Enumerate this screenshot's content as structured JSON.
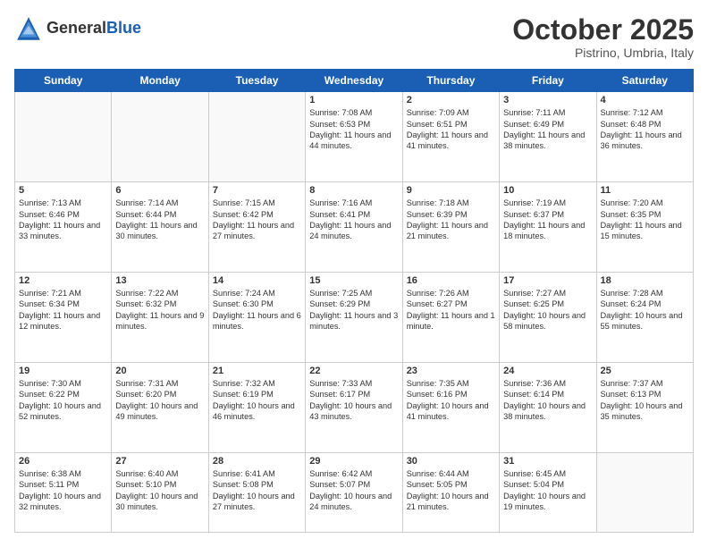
{
  "header": {
    "logo_general": "General",
    "logo_blue": "Blue",
    "month_title": "October 2025",
    "location": "Pistrino, Umbria, Italy"
  },
  "weekdays": [
    "Sunday",
    "Monday",
    "Tuesday",
    "Wednesday",
    "Thursday",
    "Friday",
    "Saturday"
  ],
  "weeks": [
    [
      {
        "day": "",
        "text": ""
      },
      {
        "day": "",
        "text": ""
      },
      {
        "day": "",
        "text": ""
      },
      {
        "day": "1",
        "text": "Sunrise: 7:08 AM\nSunset: 6:53 PM\nDaylight: 11 hours and 44 minutes."
      },
      {
        "day": "2",
        "text": "Sunrise: 7:09 AM\nSunset: 6:51 PM\nDaylight: 11 hours and 41 minutes."
      },
      {
        "day": "3",
        "text": "Sunrise: 7:11 AM\nSunset: 6:49 PM\nDaylight: 11 hours and 38 minutes."
      },
      {
        "day": "4",
        "text": "Sunrise: 7:12 AM\nSunset: 6:48 PM\nDaylight: 11 hours and 36 minutes."
      }
    ],
    [
      {
        "day": "5",
        "text": "Sunrise: 7:13 AM\nSunset: 6:46 PM\nDaylight: 11 hours and 33 minutes."
      },
      {
        "day": "6",
        "text": "Sunrise: 7:14 AM\nSunset: 6:44 PM\nDaylight: 11 hours and 30 minutes."
      },
      {
        "day": "7",
        "text": "Sunrise: 7:15 AM\nSunset: 6:42 PM\nDaylight: 11 hours and 27 minutes."
      },
      {
        "day": "8",
        "text": "Sunrise: 7:16 AM\nSunset: 6:41 PM\nDaylight: 11 hours and 24 minutes."
      },
      {
        "day": "9",
        "text": "Sunrise: 7:18 AM\nSunset: 6:39 PM\nDaylight: 11 hours and 21 minutes."
      },
      {
        "day": "10",
        "text": "Sunrise: 7:19 AM\nSunset: 6:37 PM\nDaylight: 11 hours and 18 minutes."
      },
      {
        "day": "11",
        "text": "Sunrise: 7:20 AM\nSunset: 6:35 PM\nDaylight: 11 hours and 15 minutes."
      }
    ],
    [
      {
        "day": "12",
        "text": "Sunrise: 7:21 AM\nSunset: 6:34 PM\nDaylight: 11 hours and 12 minutes."
      },
      {
        "day": "13",
        "text": "Sunrise: 7:22 AM\nSunset: 6:32 PM\nDaylight: 11 hours and 9 minutes."
      },
      {
        "day": "14",
        "text": "Sunrise: 7:24 AM\nSunset: 6:30 PM\nDaylight: 11 hours and 6 minutes."
      },
      {
        "day": "15",
        "text": "Sunrise: 7:25 AM\nSunset: 6:29 PM\nDaylight: 11 hours and 3 minutes."
      },
      {
        "day": "16",
        "text": "Sunrise: 7:26 AM\nSunset: 6:27 PM\nDaylight: 11 hours and 1 minute."
      },
      {
        "day": "17",
        "text": "Sunrise: 7:27 AM\nSunset: 6:25 PM\nDaylight: 10 hours and 58 minutes."
      },
      {
        "day": "18",
        "text": "Sunrise: 7:28 AM\nSunset: 6:24 PM\nDaylight: 10 hours and 55 minutes."
      }
    ],
    [
      {
        "day": "19",
        "text": "Sunrise: 7:30 AM\nSunset: 6:22 PM\nDaylight: 10 hours and 52 minutes."
      },
      {
        "day": "20",
        "text": "Sunrise: 7:31 AM\nSunset: 6:20 PM\nDaylight: 10 hours and 49 minutes."
      },
      {
        "day": "21",
        "text": "Sunrise: 7:32 AM\nSunset: 6:19 PM\nDaylight: 10 hours and 46 minutes."
      },
      {
        "day": "22",
        "text": "Sunrise: 7:33 AM\nSunset: 6:17 PM\nDaylight: 10 hours and 43 minutes."
      },
      {
        "day": "23",
        "text": "Sunrise: 7:35 AM\nSunset: 6:16 PM\nDaylight: 10 hours and 41 minutes."
      },
      {
        "day": "24",
        "text": "Sunrise: 7:36 AM\nSunset: 6:14 PM\nDaylight: 10 hours and 38 minutes."
      },
      {
        "day": "25",
        "text": "Sunrise: 7:37 AM\nSunset: 6:13 PM\nDaylight: 10 hours and 35 minutes."
      }
    ],
    [
      {
        "day": "26",
        "text": "Sunrise: 6:38 AM\nSunset: 5:11 PM\nDaylight: 10 hours and 32 minutes."
      },
      {
        "day": "27",
        "text": "Sunrise: 6:40 AM\nSunset: 5:10 PM\nDaylight: 10 hours and 30 minutes."
      },
      {
        "day": "28",
        "text": "Sunrise: 6:41 AM\nSunset: 5:08 PM\nDaylight: 10 hours and 27 minutes."
      },
      {
        "day": "29",
        "text": "Sunrise: 6:42 AM\nSunset: 5:07 PM\nDaylight: 10 hours and 24 minutes."
      },
      {
        "day": "30",
        "text": "Sunrise: 6:44 AM\nSunset: 5:05 PM\nDaylight: 10 hours and 21 minutes."
      },
      {
        "day": "31",
        "text": "Sunrise: 6:45 AM\nSunset: 5:04 PM\nDaylight: 10 hours and 19 minutes."
      },
      {
        "day": "",
        "text": ""
      }
    ]
  ]
}
